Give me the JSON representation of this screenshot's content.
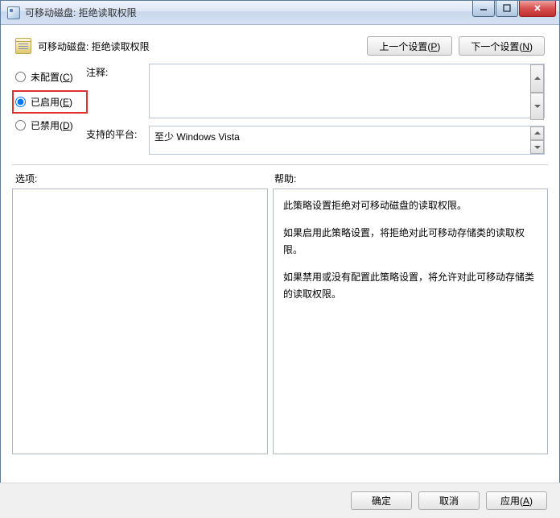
{
  "window": {
    "title": "可移动磁盘: 拒绝读取权限"
  },
  "header": {
    "policy_title": "可移动磁盘: 拒绝读取权限",
    "prev_btn": "上一个设置(P)",
    "next_btn": "下一个设置(N)"
  },
  "state": {
    "not_configured": "未配置(C)",
    "enabled": "已启用(E)",
    "disabled": "已禁用(D)",
    "selected": "enabled"
  },
  "fields": {
    "comment_label": "注释:",
    "comment_value": "",
    "platform_label": "支持的平台:",
    "platform_value": "至少 Windows Vista"
  },
  "sections": {
    "options_label": "选项:",
    "help_label": "帮助:"
  },
  "help_text": {
    "p1": "此策略设置拒绝对可移动磁盘的读取权限。",
    "p2": "如果启用此策略设置，将拒绝对此可移动存储类的读取权限。",
    "p3": "如果禁用或没有配置此策略设置，将允许对此可移动存储类的读取权限。"
  },
  "footer": {
    "ok": "确定",
    "cancel": "取消",
    "apply": "应用(A)"
  }
}
